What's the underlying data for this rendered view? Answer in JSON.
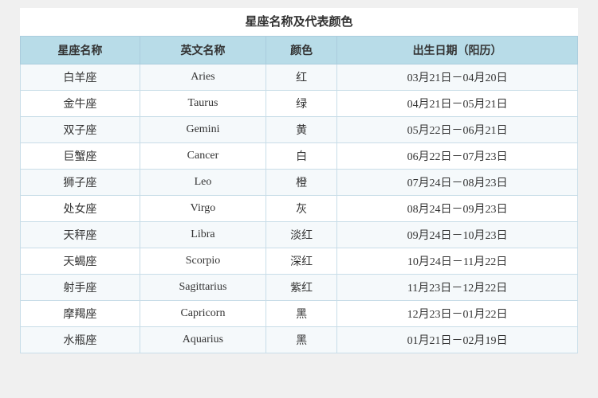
{
  "page": {
    "title": "星座名称及代表颜色",
    "headers": [
      "星座名称",
      "英文名称",
      "颜色",
      "出生日期（阳历）"
    ],
    "rows": [
      {
        "chinese": "白羊座",
        "english": "Aries",
        "color": "红",
        "dates": "03月21日－04月20日"
      },
      {
        "chinese": "金牛座",
        "english": "Taurus",
        "color": "绿",
        "dates": "04月21日－05月21日"
      },
      {
        "chinese": "双子座",
        "english": "Gemini",
        "color": "黄",
        "dates": "05月22日－06月21日"
      },
      {
        "chinese": "巨蟹座",
        "english": "Cancer",
        "color": "白",
        "dates": "06月22日－07月23日"
      },
      {
        "chinese": "狮子座",
        "english": "Leo",
        "color": "橙",
        "dates": "07月24日－08月23日"
      },
      {
        "chinese": "处女座",
        "english": "Virgo",
        "color": "灰",
        "dates": "08月24日－09月23日"
      },
      {
        "chinese": "天秤座",
        "english": "Libra",
        "color": "淡红",
        "dates": "09月24日－10月23日"
      },
      {
        "chinese": "天蝎座",
        "english": "Scorpio",
        "color": "深红",
        "dates": "10月24日－11月22日"
      },
      {
        "chinese": "射手座",
        "english": "Sagittarius",
        "color": "紫红",
        "dates": "11月23日－12月22日"
      },
      {
        "chinese": "摩羯座",
        "english": "Capricorn",
        "color": "黑",
        "dates": "12月23日－01月22日"
      },
      {
        "chinese": "水瓶座",
        "english": "Aquarius",
        "color": "黑",
        "dates": "01月21日－02月19日"
      }
    ]
  }
}
